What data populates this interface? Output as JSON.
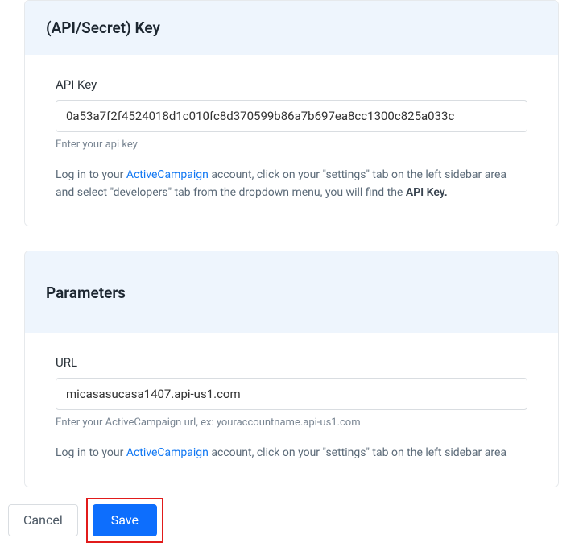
{
  "sections": {
    "api": {
      "title": "(API/Secret) Key",
      "field_label": "API Key",
      "value": "0a53a7f2f4524018d1c010fc8d370599b86a7b697ea8cc1300c825a033c",
      "helper": "Enter your api key",
      "instruction_pre": "Log in to your ",
      "instruction_link": "ActiveCampaign",
      "instruction_mid": " account, click on your \"settings\" tab on the left sidebar area and select \"developers\" tab from the dropdown menu, you will find the ",
      "instruction_bold": "API Key."
    },
    "params": {
      "title": "Parameters",
      "field_label": "URL",
      "value": "micasasucasa1407.api-us1.com",
      "helper": "Enter your ActiveCampaign url, ex: youraccountname.api-us1.com",
      "instruction_pre": "Log in to your ",
      "instruction_link": "ActiveCampaign",
      "instruction_post": " account, click on your \"settings\" tab on the left sidebar area"
    }
  },
  "buttons": {
    "cancel": "Cancel",
    "save": "Save"
  }
}
